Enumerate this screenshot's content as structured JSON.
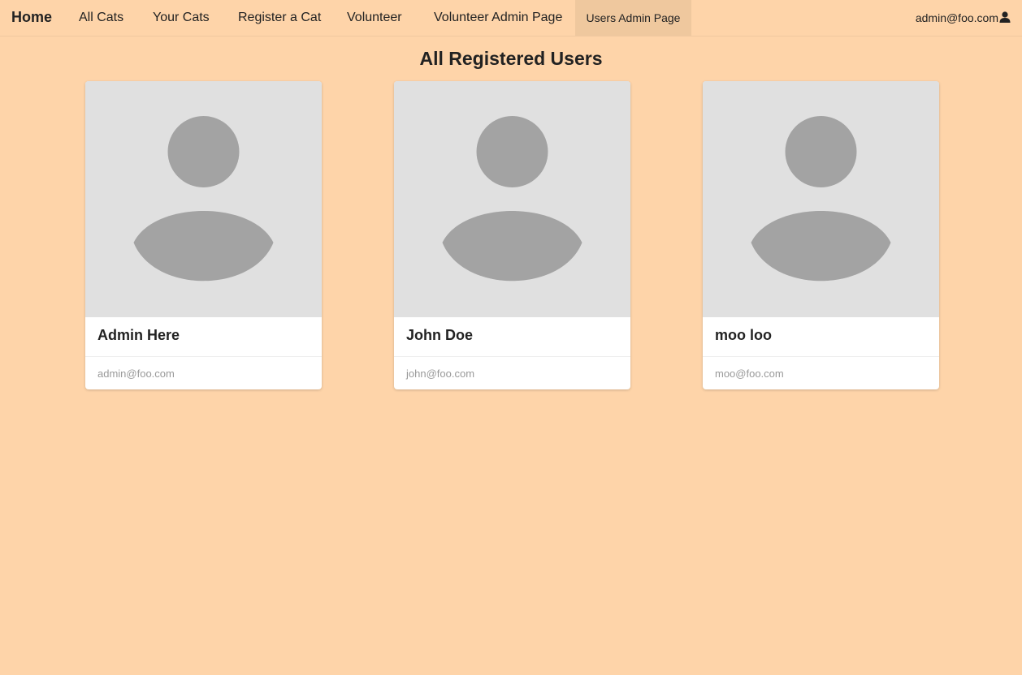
{
  "nav": {
    "home": "Home",
    "items": [
      {
        "label": "All Cats"
      },
      {
        "label": "Your Cats"
      },
      {
        "label": "Register a Cat"
      },
      {
        "label": "Volunteer"
      },
      {
        "label": "Volunteer Admin Page"
      },
      {
        "label": "Users Admin Page",
        "active": true
      }
    ],
    "user_email": "admin@foo.com",
    "user_icon": "user-icon"
  },
  "page": {
    "title": "All Registered Users"
  },
  "users": [
    {
      "name": "Admin Here",
      "email": "admin@foo.com",
      "avatar_icon": "avatar-placeholder-icon"
    },
    {
      "name": "John Doe",
      "email": "john@foo.com",
      "avatar_icon": "avatar-placeholder-icon"
    },
    {
      "name": "moo loo",
      "email": "moo@foo.com",
      "avatar_icon": "avatar-placeholder-icon"
    }
  ],
  "colors": {
    "background": "#fed4a9",
    "nav_active": "#efc89e",
    "avatar_bg": "#e0e0e0",
    "avatar_fg": "#a3a3a3"
  }
}
